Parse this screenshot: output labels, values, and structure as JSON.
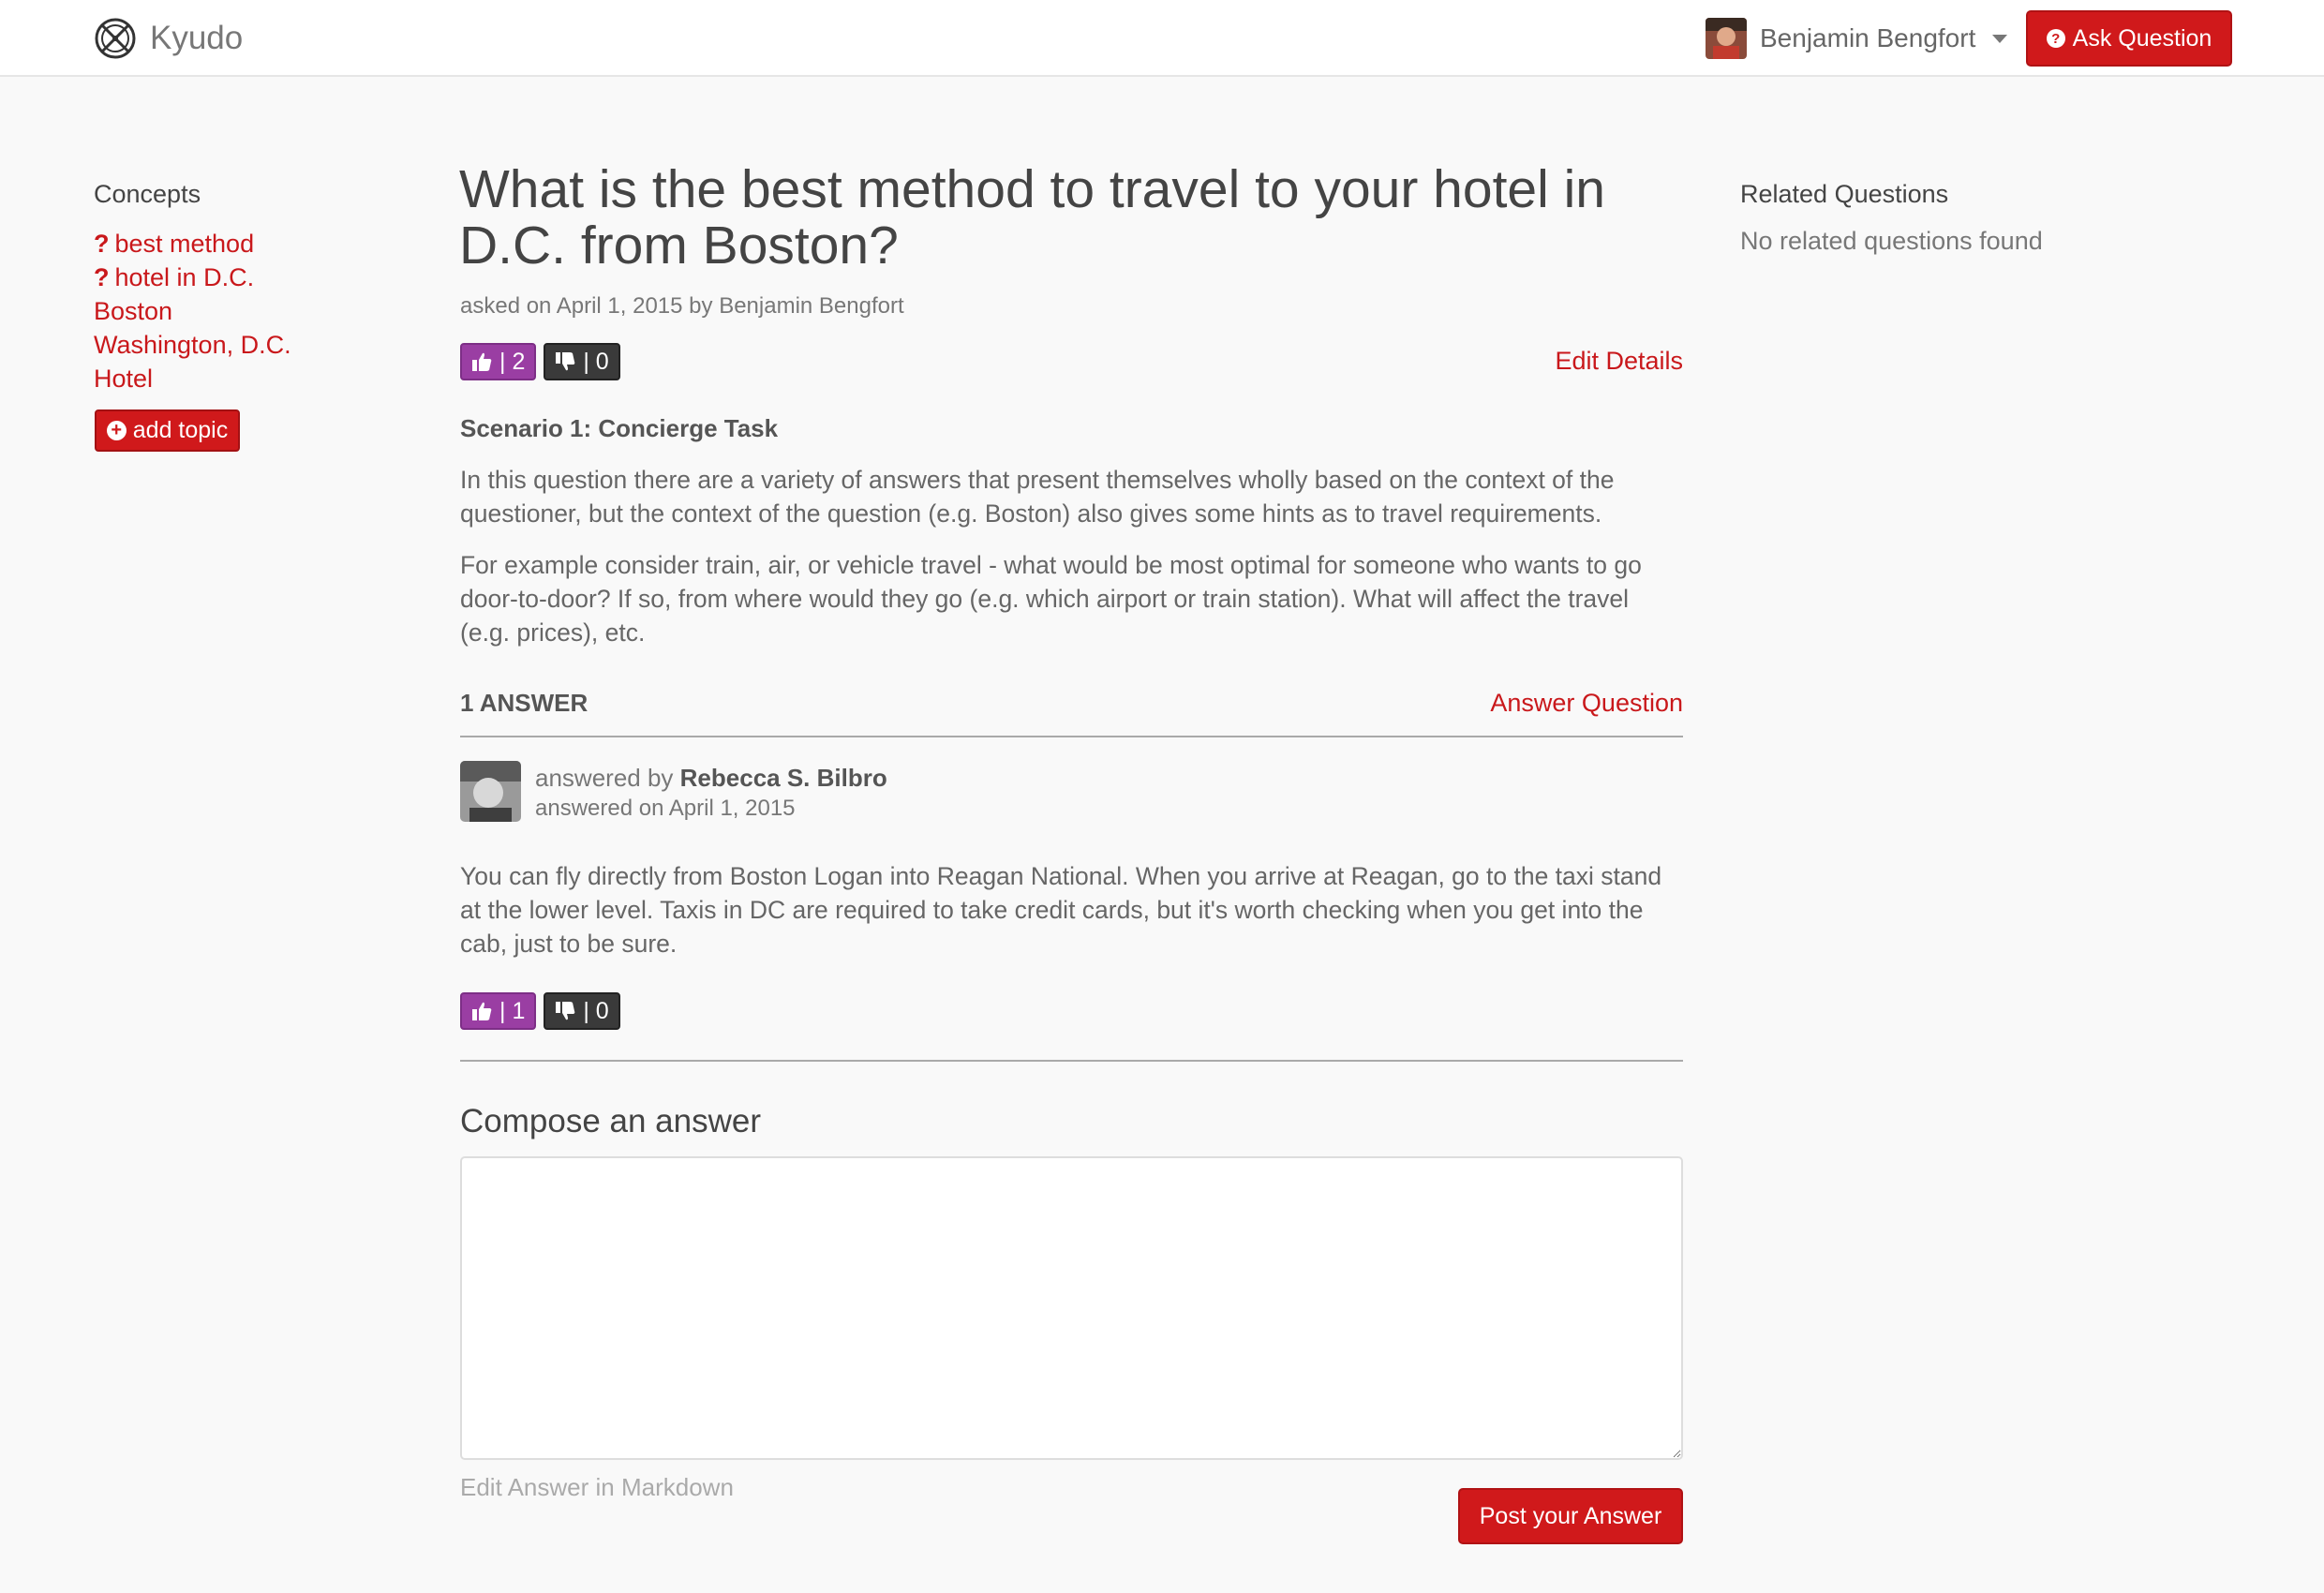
{
  "navbar": {
    "brand": "Kyudo",
    "user_name": "Benjamin Bengfort",
    "ask_button": "Ask Question"
  },
  "concepts": {
    "heading": "Concepts",
    "items": [
      {
        "label": "best method",
        "suggested": true
      },
      {
        "label": "hotel in D.C.",
        "suggested": true
      },
      {
        "label": "Boston",
        "suggested": false
      },
      {
        "label": "Washington, D.C.",
        "suggested": false
      },
      {
        "label": "Hotel",
        "suggested": false
      }
    ],
    "add_topic": "add topic"
  },
  "question": {
    "title": "What is the best method to travel to your hotel in D.C. from Boston?",
    "meta": "asked on April 1, 2015 by Benjamin Bengfort",
    "upvotes": "| 2",
    "downvotes": "| 0",
    "edit_details": "Edit Details",
    "scenario_title": "Scenario 1: Concierge Task",
    "paragraphs": [
      "In this question there are a variety of answers that present themselves wholly based on the context of the questioner, but the context of the question (e.g. Boston) also gives some hints as to travel requirements.",
      "For example consider train, air, or vehicle travel - what would be most optimal for someone who wants to go door-to-door? If so, from where would they go (e.g. which airport or train station). What will affect the travel (e.g. prices), etc."
    ]
  },
  "answers": {
    "count_label": "1 ANSWER",
    "answer_question": "Answer Question",
    "items": [
      {
        "answered_by_prefix": "answered by",
        "author": "Rebecca S. Bilbro",
        "date": "answered on April 1, 2015",
        "body": "You can fly directly from Boston Logan into Reagan National. When you arrive at Reagan, go to the taxi stand at the lower level. Taxis in DC are required to take credit cards, but it's worth checking when you get into the cab, just to be sure.",
        "upvotes": "| 1",
        "downvotes": "| 0"
      }
    ]
  },
  "compose": {
    "heading": "Compose an answer",
    "hint": "Edit Answer in Markdown",
    "post_button": "Post your Answer"
  },
  "related": {
    "heading": "Related Questions",
    "empty": "No related questions found"
  },
  "colors": {
    "accent": "#d0191b",
    "upvote": "#9a3ea3",
    "downvote": "#3a3a3a",
    "background": "#f9f9f9"
  }
}
